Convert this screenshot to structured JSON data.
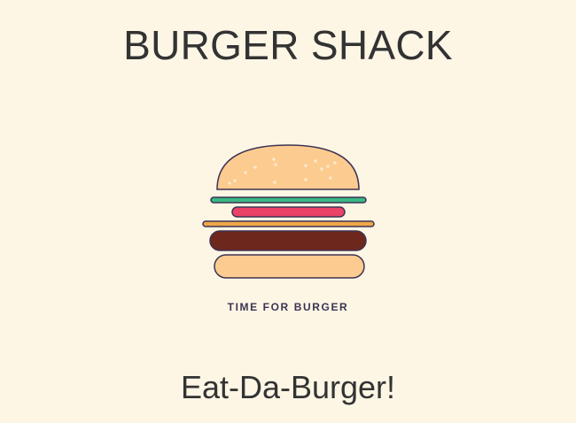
{
  "header": {
    "title": "BURGER SHACK"
  },
  "logo": {
    "icon": "burger-icon",
    "caption": "TIME FOR BURGER",
    "colors": {
      "outline": "#3d3353",
      "bun": "#fccb8f",
      "sesame": "#fde8cc",
      "lettuce": "#3ab884",
      "tomato": "#ea4367",
      "cheese": "#f0a748",
      "patty": "#6e271c"
    }
  },
  "main": {
    "tagline": "Eat-Da-Burger!"
  },
  "theme": {
    "background": "#fdf6e5",
    "text": "#333333"
  }
}
